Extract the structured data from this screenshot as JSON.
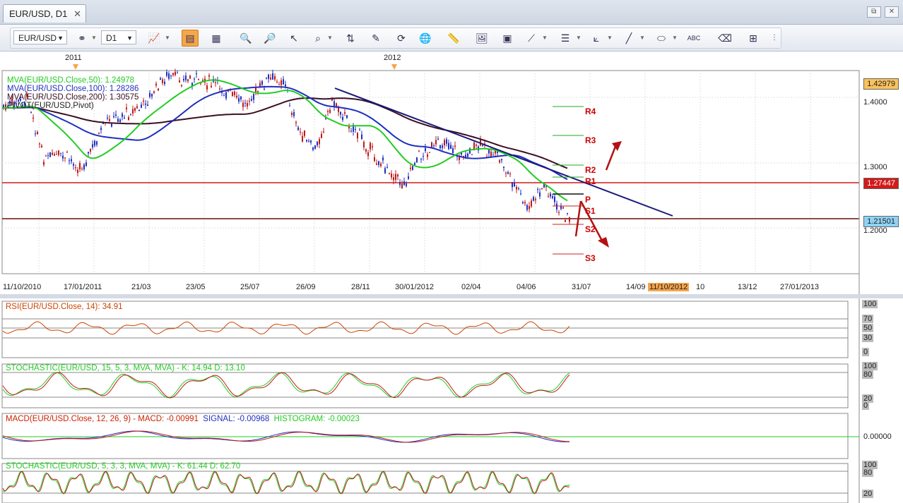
{
  "tab": {
    "title": "EUR/USD, D1",
    "close": "✕"
  },
  "window_buttons": [
    "⧉",
    "✕"
  ],
  "toolbar": {
    "symbol": "EUR/USD",
    "timeframe": "D1"
  },
  "years": [
    "2011",
    "2012"
  ],
  "main_panel": {
    "legend": [
      {
        "text": "MVA(EUR/USD.Close,50): 1.24978",
        "color": "#22cc22"
      },
      {
        "text": "MVA(EUR/USD.Close,100): 1.28286",
        "color": "#1f2fbf"
      },
      {
        "text": "MVA(EUR/USD.Close,200): 1.30575",
        "color": "#3b0f23"
      },
      {
        "text": "PIVOT(EUR/USD,Pivot)",
        "color": "#222222"
      }
    ],
    "price_ticks": [
      "1.4000",
      "1.3000",
      "1.2000"
    ],
    "price_tags": {
      "top": "1.42979",
      "resistance": "1.27447",
      "current": "1.21501"
    },
    "pivot_labels": [
      "R4",
      "R3",
      "R2",
      "R1",
      "P",
      "S1",
      "S2",
      "S3"
    ],
    "x_labels": [
      "11/10/2010",
      "17/01/2011",
      "21/03",
      "23/05",
      "25/07",
      "26/09",
      "28/11",
      "30/01/2012",
      "02/04",
      "04/06",
      "31/07",
      "14/09",
      "11/10/2012",
      "10",
      "13/12",
      "27/01/2013"
    ]
  },
  "rsi": {
    "title": "RSI(EUR/USD.Close, 14): 34.91",
    "color": "#cc4400",
    "levels": [
      "100",
      "70",
      "50",
      "30",
      "0"
    ]
  },
  "stoch1": {
    "title": "STOCHASTIC(EUR/USD, 15, 5, 3, MVA, MVA) -  K: 14.94   D: 13.10",
    "levels": [
      "100",
      "80",
      "20",
      "0"
    ]
  },
  "macd": {
    "title_main": "MACD(EUR/USD.Close, 12, 26, 9) -  MACD: -0.00991",
    "title_signal": "SIGNAL: -0.00968",
    "title_hist": "HISTOGRAM: -0.00023",
    "zero": "0.00000"
  },
  "stoch2": {
    "title": "STOCHASTIC(EUR/USD, 5, 3, 3, MVA, MVA) -  K: 61.44   D: 62.70",
    "levels": [
      "100",
      "80",
      "20"
    ]
  }
}
